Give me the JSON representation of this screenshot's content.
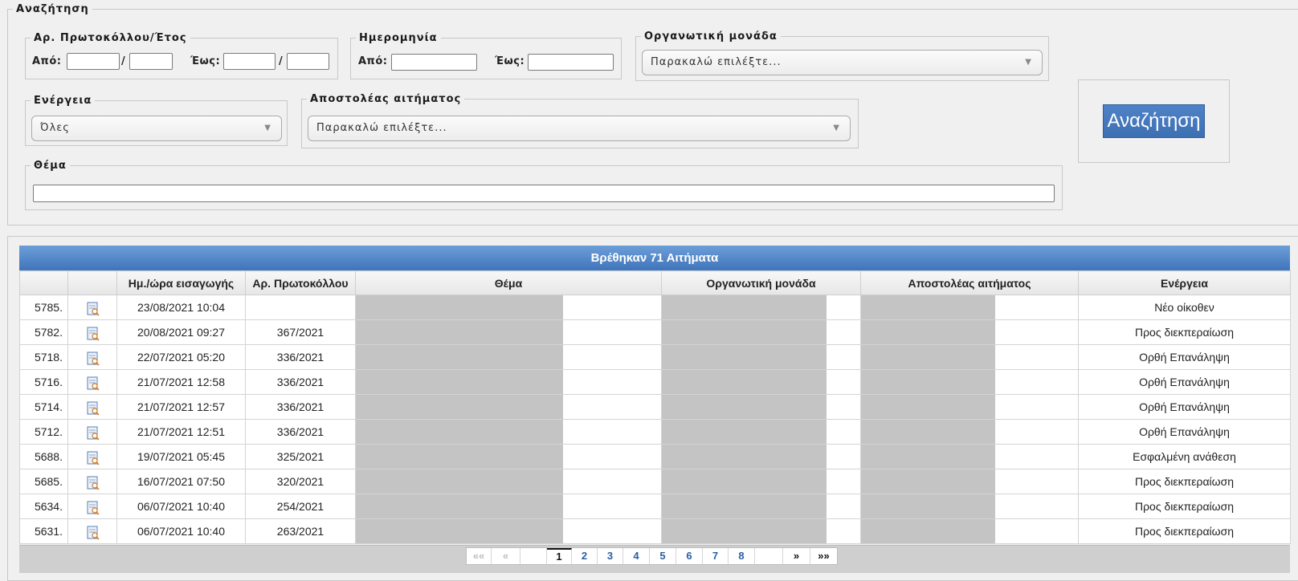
{
  "search": {
    "legend": "Αναζήτηση",
    "protocol": {
      "legend": "Αρ. Πρωτοκόλλου/Έτος",
      "from_label": "Από:",
      "to_label": "Έως:",
      "sep": "/"
    },
    "date": {
      "legend": "Ημερομηνία",
      "from_label": "Από:",
      "to_label": "Έως:"
    },
    "org_unit": {
      "legend": "Οργανωτική μονάδα",
      "value": "Παρακαλώ επιλέξτε..."
    },
    "action": {
      "legend": "Ενέργεια",
      "value": "Όλες"
    },
    "sender": {
      "legend": "Αποστολέας αιτήματος",
      "value": "Παρακαλώ επιλέξτε..."
    },
    "subject": {
      "legend": "Θέμα",
      "value": ""
    },
    "button_label": "Αναζήτηση"
  },
  "results": {
    "title": "Βρέθηκαν 71 Αιτήματα",
    "columns": [
      "",
      "",
      "Ημ./ώρα εισαγωγής",
      "Αρ. Πρωτοκόλλου",
      "Θέμα",
      "Οργανωτική μονάδα",
      "Αποστολέας αιτήματος",
      "Ενέργεια"
    ],
    "rows": [
      {
        "id": "5785.",
        "datetime": "23/08/2021 10:04",
        "protocol": "",
        "action": "Νέο οίκοθεν"
      },
      {
        "id": "5782.",
        "datetime": "20/08/2021 09:27",
        "protocol": "367/2021",
        "action": "Προς διεκπεραίωση"
      },
      {
        "id": "5718.",
        "datetime": "22/07/2021 05:20",
        "protocol": "336/2021",
        "action": "Ορθή Επανάληψη"
      },
      {
        "id": "5716.",
        "datetime": "21/07/2021 12:58",
        "protocol": "336/2021",
        "action": "Ορθή Επανάληψη"
      },
      {
        "id": "5714.",
        "datetime": "21/07/2021 12:57",
        "protocol": "336/2021",
        "action": "Ορθή Επανάληψη"
      },
      {
        "id": "5712.",
        "datetime": "21/07/2021 12:51",
        "protocol": "336/2021",
        "action": "Ορθή Επανάληψη"
      },
      {
        "id": "5688.",
        "datetime": "19/07/2021 05:45",
        "protocol": "325/2021",
        "action": "Εσφαλμένη ανάθεση"
      },
      {
        "id": "5685.",
        "datetime": "16/07/2021 07:50",
        "protocol": "320/2021",
        "action": "Προς διεκπεραίωση"
      },
      {
        "id": "5634.",
        "datetime": "06/07/2021 10:40",
        "protocol": "254/2021",
        "action": "Προς διεκπεραίωση"
      },
      {
        "id": "5631.",
        "datetime": "06/07/2021 10:40",
        "protocol": "263/2021",
        "action": "Προς διεκπεραίωση"
      }
    ],
    "row_icon": "document-view-icon"
  },
  "pager": {
    "first": "««",
    "prev": "«",
    "pages": [
      "1",
      "2",
      "3",
      "4",
      "5",
      "6",
      "7",
      "8"
    ],
    "current": "1",
    "next": "»",
    "last": "»»"
  },
  "colors": {
    "header_blue": "#3f74bb",
    "button_blue": "#4a7cc0",
    "redaction": "#c4c4c4"
  }
}
